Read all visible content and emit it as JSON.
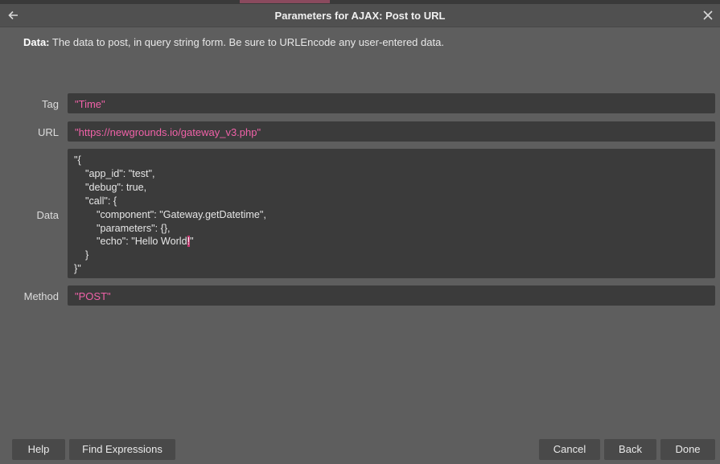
{
  "window": {
    "title": "Parameters for AJAX: Post to URL"
  },
  "description": {
    "label": "Data:",
    "text": " The data to post, in query string form. Be sure to URLEncode any user-entered data."
  },
  "fields": {
    "tag": {
      "label": "Tag",
      "value": "\"Time\""
    },
    "url": {
      "label": "URL",
      "value": "\"https://newgrounds.io/gateway_v3.php\""
    },
    "data": {
      "label": "Data",
      "lines": [
        "\"{",
        "    \"app_id\": \"test\",",
        "    \"debug\": true,",
        "    \"call\": {",
        "        \"component\": \"Gateway.getDatetime\",",
        "        \"parameters\": {},",
        "        \"echo\": \"Hello World",
        "    }",
        "}\""
      ],
      "cursor_char": "!",
      "line7_tail": "\""
    },
    "method": {
      "label": "Method",
      "value": "\"POST\""
    }
  },
  "buttons": {
    "help": "Help",
    "find_expressions": "Find Expressions",
    "cancel": "Cancel",
    "back": "Back",
    "done": "Done"
  },
  "colors": {
    "background": "#5e5e5e",
    "field_bg": "#3b3b3b",
    "string": "#f062a8",
    "cursor": "#c63a72"
  }
}
